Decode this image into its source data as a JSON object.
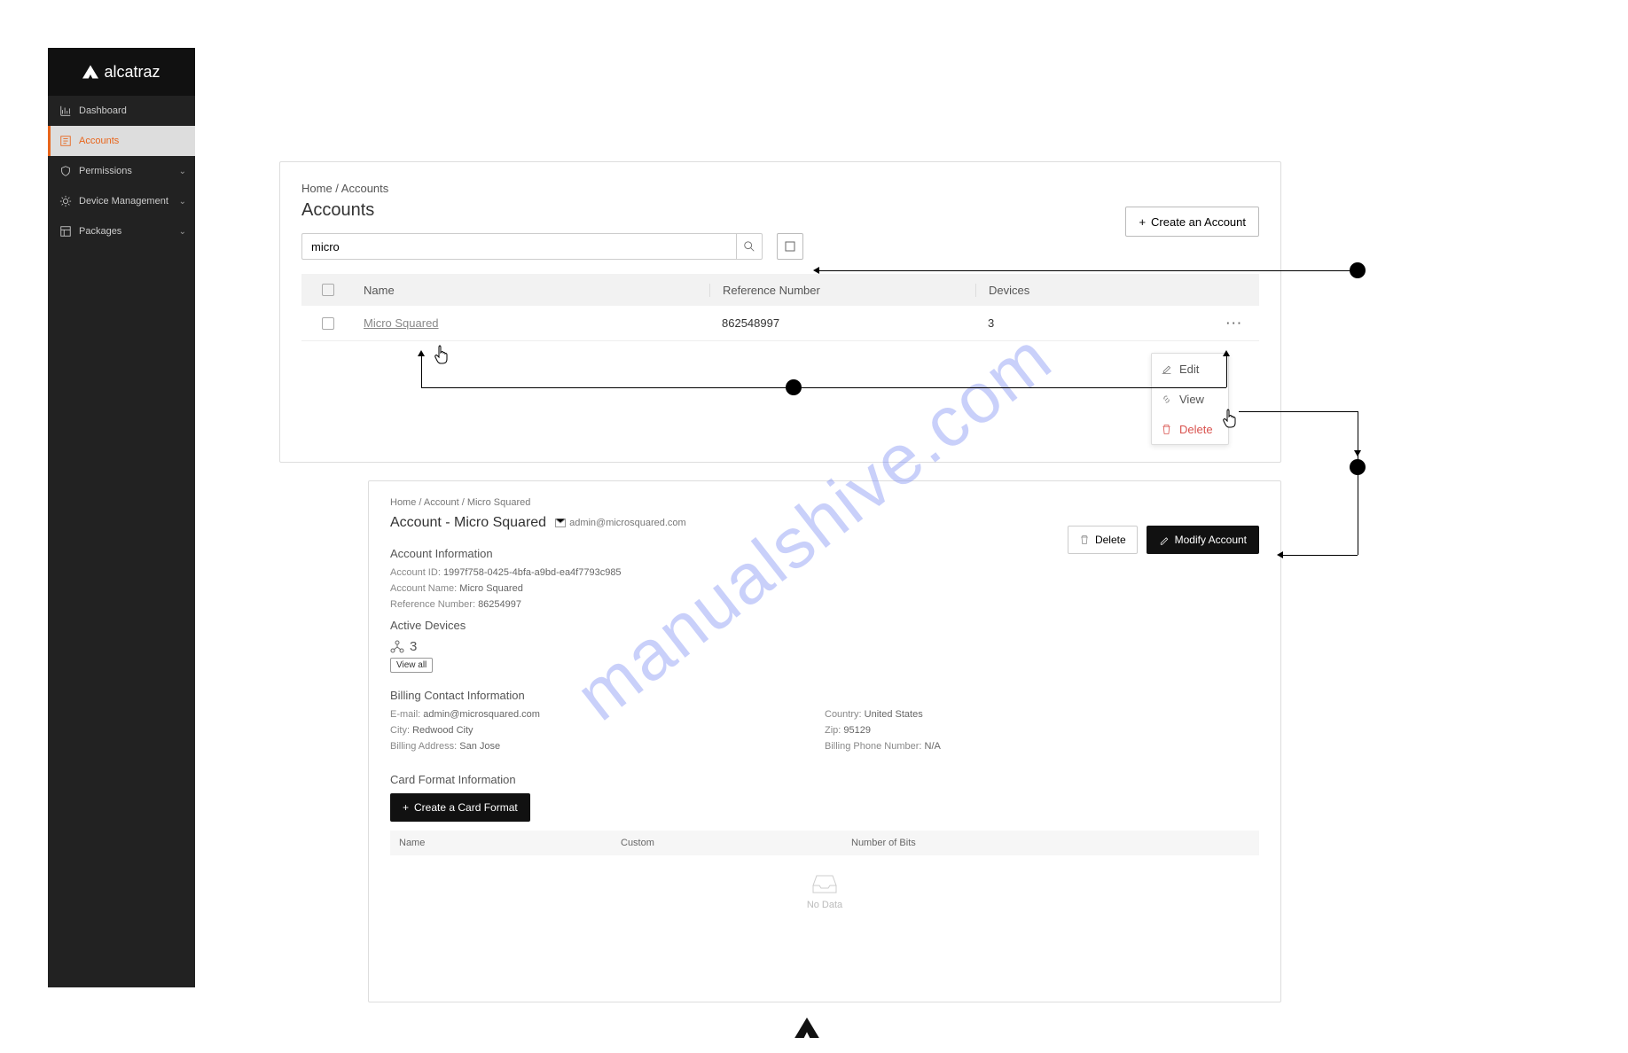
{
  "brand": "alcatraz",
  "sidebar": {
    "items": [
      {
        "label": "Dashboard",
        "icon": "chart"
      },
      {
        "label": "Accounts",
        "icon": "accounts",
        "active": true
      },
      {
        "label": "Permissions",
        "icon": "shield",
        "chev": true
      },
      {
        "label": "Device Management",
        "icon": "gear",
        "chev": true
      },
      {
        "label": "Packages",
        "icon": "package",
        "chev": true
      }
    ]
  },
  "accounts_panel": {
    "breadcrumb": "Home / Accounts",
    "title": "Accounts",
    "search_value": "micro",
    "create_label": "Create an Account",
    "columns": {
      "name": "Name",
      "ref": "Reference Number",
      "dev": "Devices"
    },
    "row": {
      "name": "Micro Squared",
      "ref": "862548997",
      "dev": "3"
    },
    "menu": {
      "edit": "Edit",
      "view": "View",
      "delete": "Delete"
    }
  },
  "detail_panel": {
    "breadcrumb": {
      "home": "Home",
      "acct": "Account",
      "name": "Micro Squared"
    },
    "title": "Account - Micro Squared",
    "email": "admin@microsquared.com",
    "delete_label": "Delete",
    "modify_label": "Modify Account",
    "sect_info": "Account Information",
    "info": {
      "id": {
        "k": "Account ID",
        "v": "1997f758-0425-4bfa-a9bd-ea4f7793c985"
      },
      "name": {
        "k": "Account Name",
        "v": "Micro Squared"
      },
      "ref": {
        "k": "Reference Number",
        "v": "86254997"
      }
    },
    "active_devices": {
      "label": "Active Devices",
      "count": "3",
      "viewall": "View all"
    },
    "sect_billing": "Billing Contact Information",
    "billing": {
      "email": {
        "k": "E-mail",
        "v": "admin@microsquared.com"
      },
      "city": {
        "k": "City",
        "v": "Redwood City"
      },
      "addr": {
        "k": "Billing Address",
        "v": "San Jose"
      },
      "country": {
        "k": "Country",
        "v": "United States"
      },
      "zip": {
        "k": "Zip",
        "v": "95129"
      },
      "phone": {
        "k": "Billing Phone Number",
        "v": "N/A"
      }
    },
    "sect_card": "Card Format Information",
    "create_cf": "Create a Card Format",
    "cf_cols": {
      "name": "Name",
      "custom": "Custom",
      "bits": "Number of Bits"
    },
    "nodata": "No Data"
  },
  "watermark": "manualshive.com"
}
